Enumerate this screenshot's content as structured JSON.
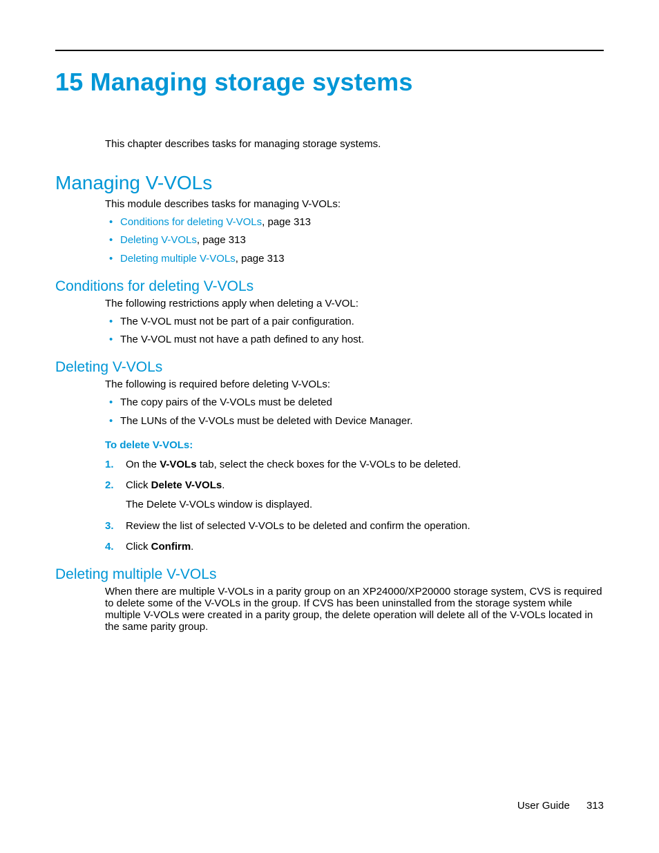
{
  "chapter": {
    "title": "15 Managing storage systems",
    "intro": "This chapter describes tasks for managing storage systems."
  },
  "section1": {
    "title": "Managing V-VOLs",
    "intro": "This module describes tasks for managing V-VOLs:",
    "links": [
      {
        "text": "Conditions for deleting V-VOLs",
        "suffix": ", page 313"
      },
      {
        "text": "Deleting V-VOLs",
        "suffix": ", page 313"
      },
      {
        "text": "Deleting multiple V-VOLs",
        "suffix": ", page 313"
      }
    ]
  },
  "sub1": {
    "title": "Conditions for deleting V-VOLs",
    "intro": "The following restrictions apply when deleting a V-VOL:",
    "bullets": [
      "The V-VOL must not be part of a pair configuration.",
      "The V-VOL must not have a path defined to any host."
    ]
  },
  "sub2": {
    "title": "Deleting V-VOLs",
    "intro": "The following is required before deleting V-VOLs:",
    "bullets": [
      "The copy pairs of the V-VOLs must be deleted",
      "The LUNs of the V-VOLs must be deleted with Device Manager."
    ],
    "procTitle": "To delete V-VOLs:",
    "steps": {
      "s1a": "On the ",
      "s1b": "V-VOLs",
      "s1c": " tab, select the check boxes for the V-VOLs to be deleted.",
      "s2a": "Click ",
      "s2b": "Delete V-VOLs",
      "s2c": ".",
      "s2sub": "The Delete V-VOLs window is displayed.",
      "s3": "Review the list of selected V-VOLs to be deleted and confirm the operation.",
      "s4a": "Click ",
      "s4b": "Confirm",
      "s4c": "."
    }
  },
  "sub3": {
    "title": "Deleting multiple V-VOLs",
    "body": "When there are multiple V-VOLs in a parity group on an XP24000/XP20000 storage system, CVS is required to delete some of the V-VOLs in the group. If CVS has been uninstalled from the storage system while multiple V-VOLs were created in a parity group, the delete operation will delete all of the V-VOLs located in the same parity group."
  },
  "footer": {
    "label": "User Guide",
    "page": "313"
  }
}
